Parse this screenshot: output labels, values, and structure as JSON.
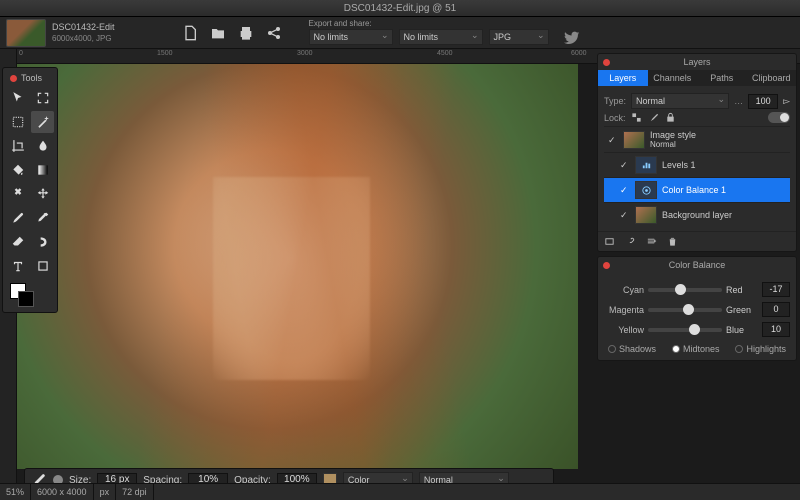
{
  "titlebar": "DSC01432-Edit.jpg @ 51",
  "file": {
    "name": "DSC01432-Edit",
    "dims_fmt": "6000x4000,  JPG"
  },
  "export": {
    "label": "Export and share:",
    "limit1": "No limits",
    "limit2": "No limits",
    "format": "JPG"
  },
  "ruler_marks": {
    "m1": "0",
    "m2": "1500",
    "m3": "3000",
    "m4": "4500",
    "m5": "6000"
  },
  "toolbox_title": "Tools",
  "layers": {
    "title": "Layers",
    "tabs": {
      "layers": "Layers",
      "channels": "Channels",
      "paths": "Paths",
      "clipboard": "Clipboard"
    },
    "type_label": "Type:",
    "type_value": "Normal",
    "opacity": "100",
    "lock_label": "Lock:",
    "style_name": "Image style",
    "style_mode": "Normal",
    "l1": "Levels  1",
    "l2": "Color Balance  1",
    "l3": "Background layer"
  },
  "colorbalance": {
    "title": "Color Balance",
    "left1": "Cyan",
    "right1": "Red",
    "val1": "-17",
    "left2": "Magenta",
    "right2": "Green",
    "val2": "0",
    "left3": "Yellow",
    "right3": "Blue",
    "val3": "10",
    "tone1": "Shadows",
    "tone2": "Midtones",
    "tone3": "Highlights"
  },
  "brush": {
    "size_label": "Size:",
    "size": "16 px",
    "spacing_label": "Spacing:",
    "spacing": "10%",
    "opacity_label": "Opacity:",
    "opacity": "100%",
    "color_label": "Color",
    "mode": "Normal"
  },
  "status": {
    "zoom": "51%",
    "dims": "6000 x 4000",
    "unit": "px",
    "dpi": "72  dpi"
  }
}
